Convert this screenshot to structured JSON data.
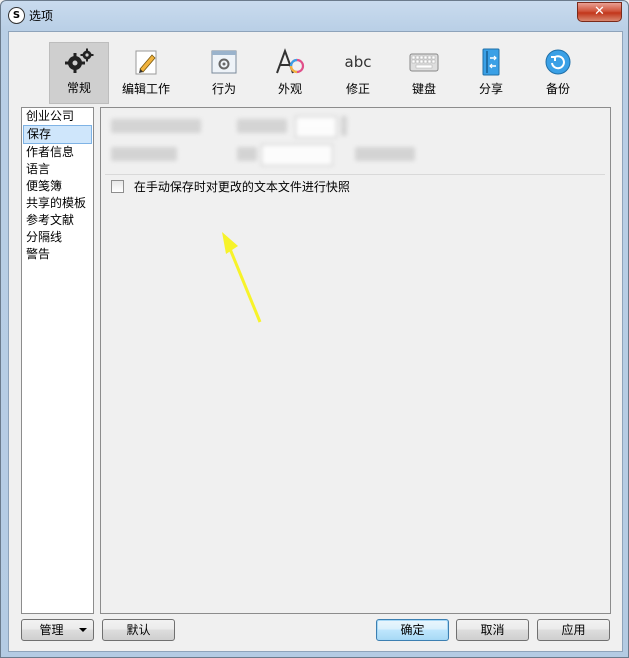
{
  "window": {
    "title": "选项",
    "logo_letter": "S",
    "close_glyph": "✕"
  },
  "toolbar": [
    {
      "label": "常规",
      "icon": "gears-icon",
      "active": true
    },
    {
      "label": "编辑工作",
      "icon": "edit-pen-icon"
    },
    {
      "label": "行为",
      "icon": "window-gear-icon"
    },
    {
      "label": "外观",
      "icon": "appearance-a-icon"
    },
    {
      "label": "修正",
      "icon": "abc-correction-icon",
      "icon_text": "abc"
    },
    {
      "label": "键盘",
      "icon": "keyboard-icon"
    },
    {
      "label": "分享",
      "icon": "share-binder-icon"
    },
    {
      "label": "备份",
      "icon": "backup-sync-icon"
    }
  ],
  "sidebar": {
    "items": [
      "创业公司",
      "保存",
      "作者信息",
      "语言",
      "便笺簿",
      "共享的模板",
      "参考文献",
      "分隔线",
      "警告"
    ],
    "selected_index": 1
  },
  "main": {
    "snapshot_checkbox": {
      "label": "在手动保存时对更改的文本文件进行快照",
      "checked": false
    }
  },
  "buttons": {
    "manage": "管理",
    "defaults": "默认",
    "ok": "确定",
    "cancel": "取消",
    "apply": "应用"
  },
  "colors": {
    "arrow": "#f7f32a",
    "selection": "#cfe6fb",
    "accent_blue": "#3aa0e6"
  }
}
